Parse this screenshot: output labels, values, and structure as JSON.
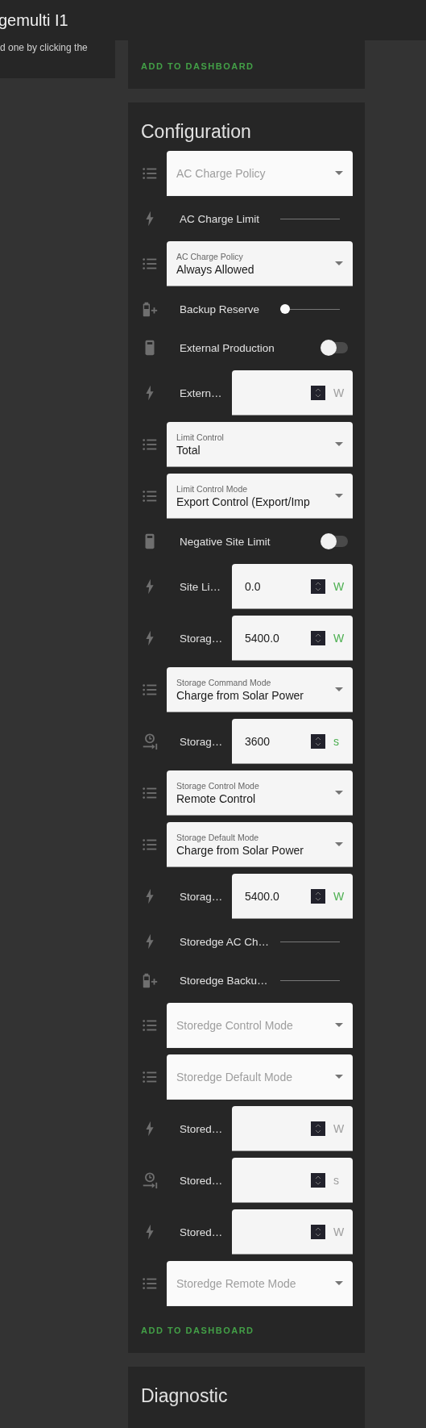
{
  "header": {
    "title": "gemulti I1"
  },
  "side_card": {
    "text": "d one by clicking the"
  },
  "top_card": {
    "action": "ADD TO DASHBOARD"
  },
  "config": {
    "title": "Configuration",
    "rows": [
      {
        "kind": "select",
        "label": "AC Charge Policy"
      },
      {
        "kind": "slider",
        "label": "AC Charge Limit"
      },
      {
        "kind": "select",
        "label": "AC Charge Policy",
        "value": "Always Allowed"
      },
      {
        "kind": "slider",
        "label": "Backup Reserve",
        "level": 0
      },
      {
        "kind": "toggle",
        "label": "External Production",
        "on": false
      },
      {
        "kind": "number",
        "label": "Extern…",
        "unit": "W"
      },
      {
        "kind": "select",
        "label": "Limit Control",
        "value": "Total"
      },
      {
        "kind": "select",
        "label": "Limit Control Mode",
        "value": "Export Control (Export/Imp"
      },
      {
        "kind": "toggle",
        "label": "Negative Site Limit",
        "on": false
      },
      {
        "kind": "number",
        "label": "Site Li…",
        "value": "0.0",
        "unit": "W"
      },
      {
        "kind": "number",
        "label": "Storag…",
        "value": "5400.0",
        "unit": "W"
      },
      {
        "kind": "select",
        "label": "Storage Command Mode",
        "value": "Charge from Solar Power"
      },
      {
        "kind": "number",
        "label": "Storag…",
        "value": "3600",
        "unit": "s"
      },
      {
        "kind": "select",
        "label": "Storage Control Mode",
        "value": "Remote Control"
      },
      {
        "kind": "select",
        "label": "Storage Default Mode",
        "value": "Charge from Solar Power"
      },
      {
        "kind": "number",
        "label": "Storag…",
        "value": "5400.0",
        "unit": "W"
      },
      {
        "kind": "slider",
        "label": "Storedge AC Ch…"
      },
      {
        "kind": "slider",
        "label": "Storedge Backu…"
      },
      {
        "kind": "select",
        "label": "Storedge Control Mode"
      },
      {
        "kind": "select",
        "label": "Storedge Default Mode"
      },
      {
        "kind": "number",
        "label": "Stored…",
        "unit": "W"
      },
      {
        "kind": "number",
        "label": "Stored…",
        "unit": "s"
      },
      {
        "kind": "number",
        "label": "Stored…",
        "unit": "W"
      },
      {
        "kind": "select",
        "label": "Storedge Remote Mode"
      }
    ],
    "action": "ADD TO DASHBOARD"
  },
  "diagnostic": {
    "title": "Diagnostic"
  }
}
